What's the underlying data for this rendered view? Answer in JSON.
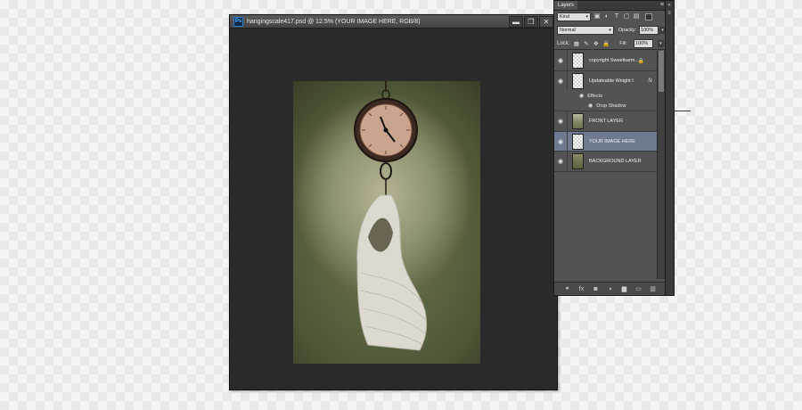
{
  "document": {
    "badge": "Ps",
    "title": "hangingscale417.psd @ 12.5% (YOUR IMAGE HERE, RGB/8)",
    "controls": {
      "minimize": "▬",
      "maximize": "❐",
      "close": "✕"
    }
  },
  "layers_panel": {
    "tab": "Layers",
    "menu": "≡",
    "filter": {
      "kind": "Kind",
      "icons": [
        "image-filter-icon",
        "adjustment-filter-icon",
        "type-filter-icon",
        "shape-filter-icon",
        "smart-object-filter-icon"
      ],
      "icon_glyphs": [
        "▣",
        "◐",
        "T",
        "▢",
        "▤"
      ]
    },
    "blend_mode": "Normal",
    "opacity_label": "Opacity:",
    "opacity_value": "100%",
    "lock_label": "Lock:",
    "lock_glyphs": [
      "▦",
      "✎",
      "✥",
      "🔒"
    ],
    "fill_label": "Fill:",
    "fill_value": "100%",
    "layers": [
      {
        "name": "copyright Sweetkarm...",
        "lock": "🔒",
        "fx": "",
        "selected": false
      },
      {
        "name": "Updateable Weight I",
        "lock": "",
        "fx": "fx",
        "selected": false
      },
      {
        "name": "FRONT LAYER",
        "lock": "",
        "fx": "",
        "selected": false
      },
      {
        "name": "YOUR IMAGE HERE",
        "lock": "",
        "fx": "",
        "selected": true
      },
      {
        "name": "BACKGROUND LAYER",
        "lock": "",
        "fx": "",
        "selected": false
      }
    ],
    "effects_label": "Effects",
    "drop_shadow_label": "Drop Shadow",
    "eye_glyph": "◉",
    "bottom_icons": [
      "⚭",
      "fx",
      "◙",
      "◑",
      "▆",
      "▭",
      "▥"
    ]
  },
  "right_strip": {
    "buttons": [
      "«",
      "≡"
    ]
  }
}
